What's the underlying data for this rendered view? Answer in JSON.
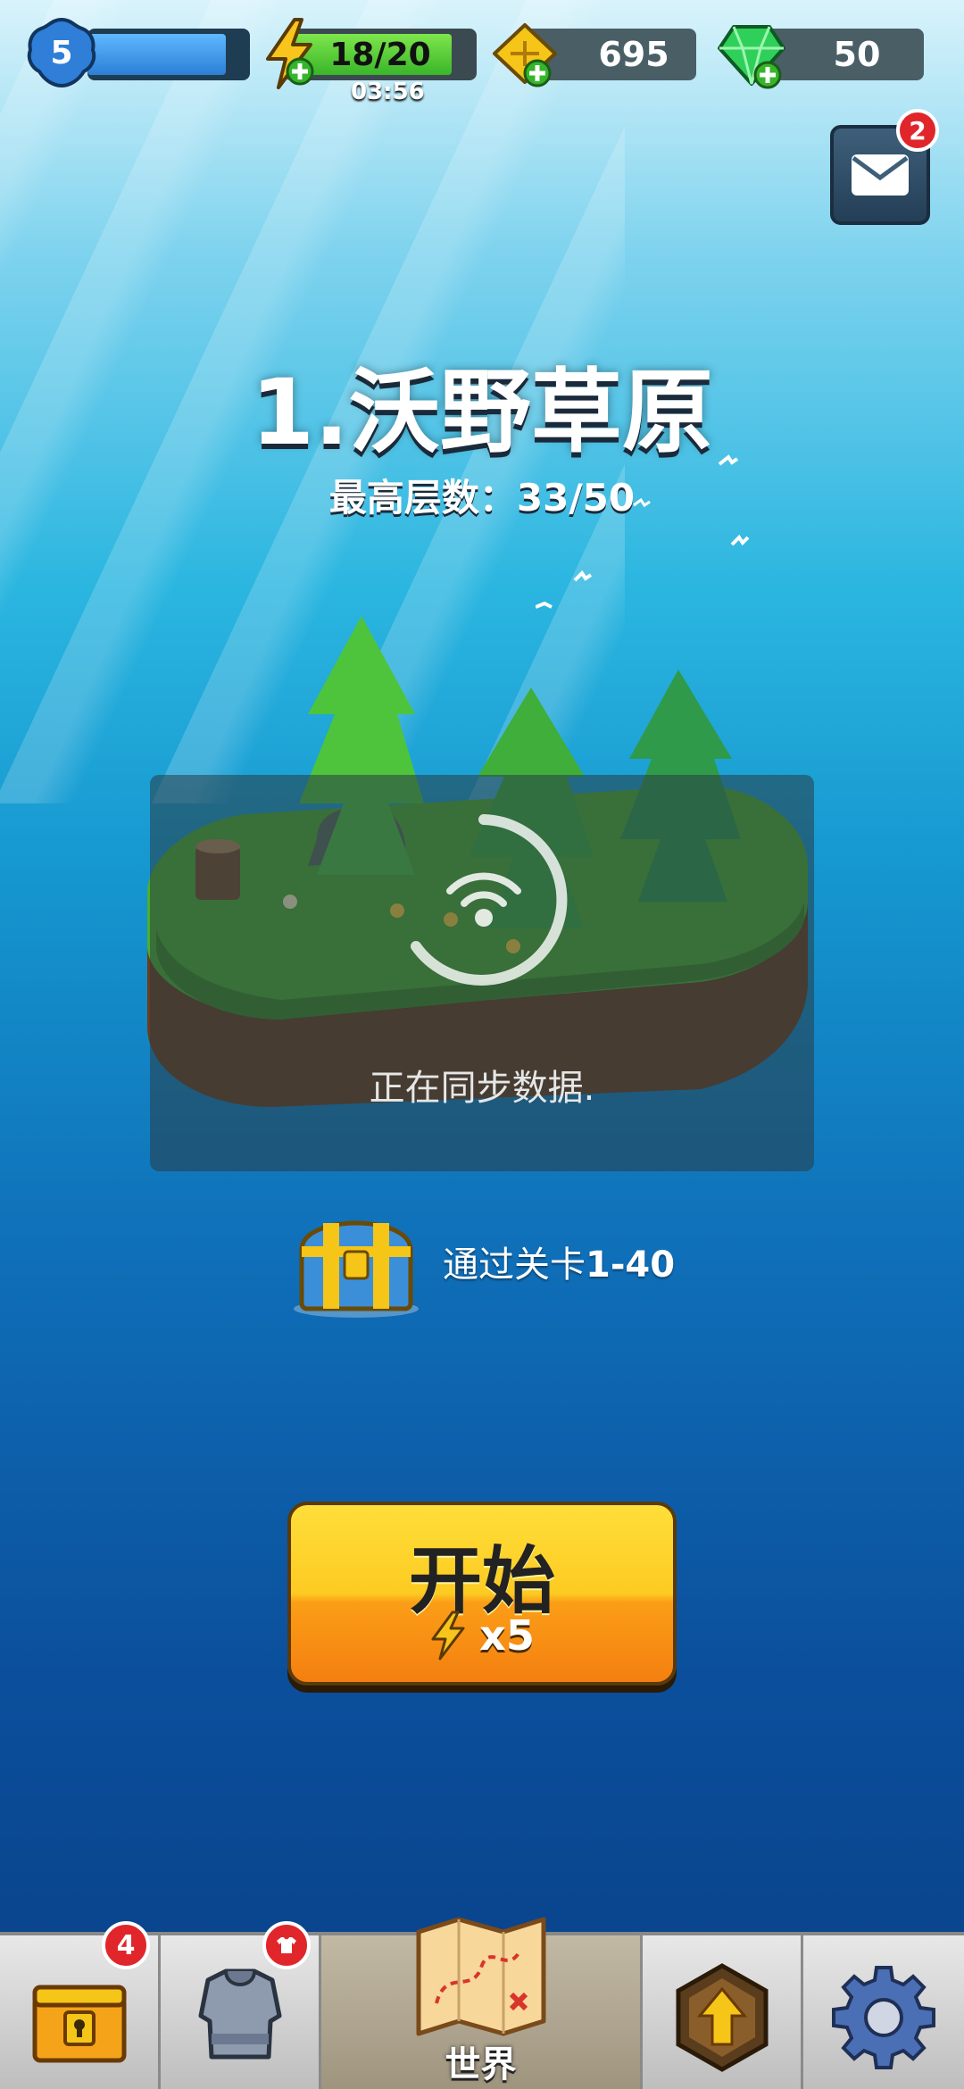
{
  "topbar": {
    "player_level": "5",
    "xp_progress": 0.85,
    "energy": "18/20",
    "energy_progress": 0.9,
    "energy_timer": "03:56",
    "gold": "695",
    "gems": "50"
  },
  "mail": {
    "badge": "2"
  },
  "stage": {
    "title": "1.沃野草原",
    "best_floor_label": "最高层数：33/50"
  },
  "sync": {
    "text": "正在同步数据."
  },
  "reward": {
    "text_prefix": "通过关卡",
    "text_levels": "1-40"
  },
  "start": {
    "label": "开始",
    "cost": "x5"
  },
  "nav": {
    "chest_badge": "4",
    "world_label": "世界"
  },
  "colors": {
    "start_top": "#ffde3a",
    "start_bottom": "#f47f10",
    "badge_red": "#e0262b",
    "energy_green": "#3ab52a",
    "gem_green": "#2fd05a",
    "gold_yellow": "#f5c518"
  },
  "icons": {
    "level": "blue-badge-icon",
    "energy": "lightning-icon",
    "gold": "gold-ticket-icon",
    "gem": "green-gem-icon",
    "mail": "envelope-icon",
    "chest": "treasure-chest-icon",
    "armor": "armor-icon",
    "map": "treasure-map-icon",
    "upgrade": "upgrade-arrow-icon",
    "settings": "gear-icon"
  }
}
